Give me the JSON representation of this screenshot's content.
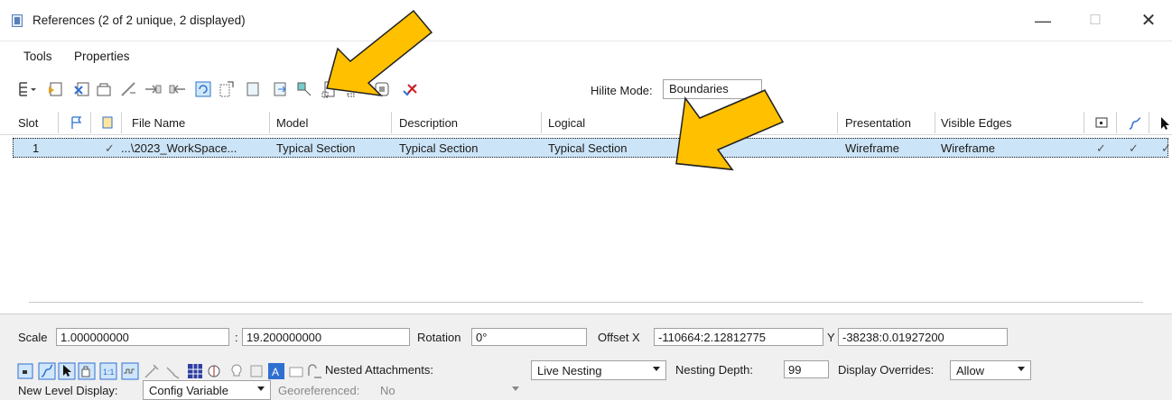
{
  "window": {
    "title": "References (2 of 2 unique, 2 displayed)",
    "minimize": "—",
    "maximize": "☐",
    "close": "✕"
  },
  "menu": [
    {
      "label": "Tools"
    },
    {
      "label": "Properties"
    }
  ],
  "toolbar": {
    "hilite_label": "Hilite Mode:",
    "hilite_value": "Boundaries"
  },
  "columns": [
    "Slot",
    "File Name",
    "Model",
    "Description",
    "Logical",
    "Presentation",
    "Visible Edges"
  ],
  "rows": [
    {
      "slot": "1",
      "check": "✓",
      "file_name": "...\\2023_WorkSpace...",
      "model": "Typical Section",
      "description": "Typical Section",
      "logical": "Typical Section",
      "presentation": "Wireframe",
      "visible_edges": "Wireframe",
      "col_display": "✓",
      "col_snap": "✓",
      "col_locate": "✓"
    }
  ],
  "properties": {
    "scale_label": "Scale",
    "scale_value": "1.000000000",
    "ratio_sep": ":",
    "ratio_value": "19.200000000",
    "rotation_label": "Rotation",
    "rotation_value": "0°",
    "offset_x_label": "Offset X",
    "offset_x_value": "-110664:2.12812775",
    "offset_y_label": "Y",
    "offset_y_value": "-38238:0.01927200",
    "nested_label": "Nested Attachments:",
    "nested_value": "Live Nesting",
    "depth_label": "Nesting Depth:",
    "depth_value": "99",
    "overrides_label": "Display Overrides:",
    "overrides_value": "Allow",
    "newlevel_label": "New Level Display:",
    "newlevel_value": "Config Variable",
    "georef_label": "Georeferenced:",
    "georef_value": "No"
  },
  "colors": {
    "selection": "#cce4f7",
    "annotation_arrow": "#ffc000",
    "icon_blue": "#2f6fd0"
  }
}
